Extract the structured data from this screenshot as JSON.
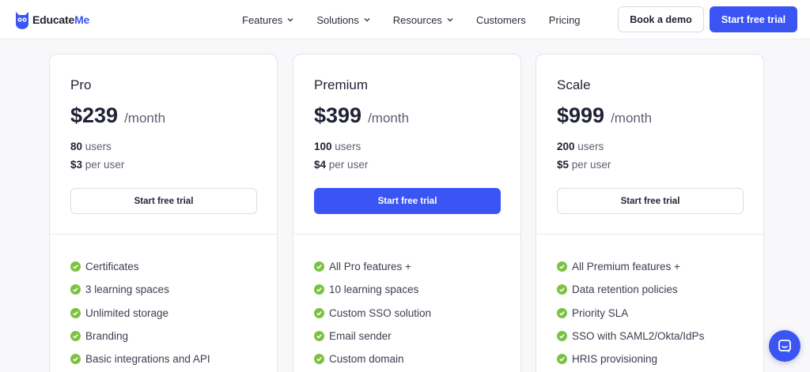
{
  "brand": {
    "name_part1": "Educate",
    "name_part2": "Me",
    "accent_color": "#3b55f5"
  },
  "nav": {
    "items": [
      {
        "label": "Features",
        "has_dropdown": true
      },
      {
        "label": "Solutions",
        "has_dropdown": true
      },
      {
        "label": "Resources",
        "has_dropdown": true
      },
      {
        "label": "Customers",
        "has_dropdown": false
      },
      {
        "label": "Pricing",
        "has_dropdown": false
      }
    ],
    "book_demo_label": "Book a demo",
    "start_trial_label": "Start free trial"
  },
  "plans": [
    {
      "name": "Pro",
      "price": "$239",
      "period": "/month",
      "users_count": "80",
      "users_label": "users",
      "per_user_price": "$3",
      "per_user_label": "per user",
      "cta_label": "Start free trial",
      "cta_primary": false,
      "features": [
        "Certificates",
        "3 learning spaces",
        "Unlimited storage",
        "Branding",
        "Basic integrations and API"
      ]
    },
    {
      "name": "Premium",
      "price": "$399",
      "period": "/month",
      "users_count": "100",
      "users_label": "users",
      "per_user_price": "$4",
      "per_user_label": "per user",
      "cta_label": "Start free trial",
      "cta_primary": true,
      "features": [
        "All Pro features +",
        "10 learning spaces",
        "Custom SSO solution",
        "Email sender",
        "Custom domain"
      ]
    },
    {
      "name": "Scale",
      "price": "$999",
      "period": "/month",
      "users_count": "200",
      "users_label": "users",
      "per_user_price": "$5",
      "per_user_label": "per user",
      "cta_label": "Start free trial",
      "cta_primary": false,
      "features": [
        "All Premium features +",
        "Data retention policies",
        "Priority SLA",
        "SSO with SAML2/Okta/IdPs",
        "HRIS provisioning"
      ]
    }
  ],
  "icons": {
    "check": "check-circle-icon",
    "chat": "chat-bubble-icon",
    "chevron": "chevron-down-icon"
  },
  "colors": {
    "check_green": "#7cc242",
    "primary": "#3b55f5"
  }
}
